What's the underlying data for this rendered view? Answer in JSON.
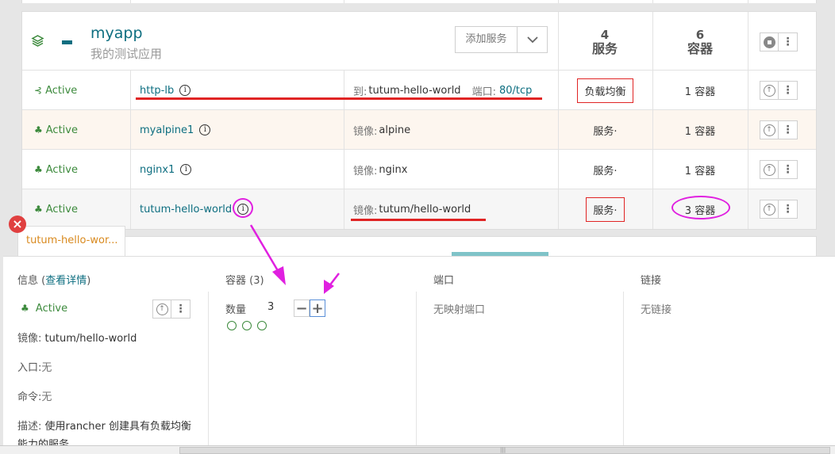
{
  "stack": {
    "name": "myapp",
    "description": "我的测试应用",
    "add_service_label": "添加服务",
    "services_count": "4",
    "services_unit": "服务",
    "containers_count": "6",
    "containers_unit": "容器"
  },
  "services": [
    {
      "status": "Active",
      "name": "http-lb",
      "detail_prefix": "到:",
      "detail_value": "tutum-hello-world",
      "port_label": "端口:",
      "port_value": "80/tcp",
      "type": "负载均衡",
      "containers": "1 容器"
    },
    {
      "status": "Active",
      "name": "myalpine1",
      "detail_prefix": "镜像:",
      "detail_value": "alpine",
      "type": "服务·",
      "containers": "1 容器"
    },
    {
      "status": "Active",
      "name": "nginx1",
      "detail_prefix": "镜像:",
      "detail_value": "nginx",
      "type": "服务·",
      "containers": "1 容器"
    },
    {
      "status": "Active",
      "name": "tutum-hello-world",
      "detail_prefix": "镜像:",
      "detail_value": "tutum/hello-world",
      "type": "服务·",
      "containers": "3 容器"
    }
  ],
  "info_i": "i",
  "tooltip_tab": "tutum-hello-wor...",
  "close_badge": "×",
  "panel": {
    "info_header": "信息 (",
    "info_link": "查看详情",
    "info_header_end": ")",
    "status": "Active",
    "image_label": "镜像:",
    "image_value": "tutum/hello-world",
    "entry_label": "入口:",
    "entry_value": "无",
    "command_label": "命令:",
    "command_value": "无",
    "desc_label": "描述:",
    "desc_value": "使用rancher 创建具有负载均衡",
    "desc_value_2": "能力的服务",
    "containers_header": "容器 (3)",
    "count_label": "数量",
    "count_value": "3",
    "minus": "−",
    "plus": "+",
    "ports_header": "端口",
    "ports_value": "无映射端口",
    "links_header": "链接",
    "links_value": "无链接"
  },
  "colors": {
    "accent": "#0d6e80",
    "active": "#3c8a3c",
    "annotation_red": "#e02424",
    "annotation_magenta": "#e020e0"
  },
  "icons": {
    "stack": "layers-icon",
    "lb": "load-balancer-icon",
    "service": "service-icon",
    "up": "upgrade-icon",
    "menu": "kebab-menu-icon",
    "stop": "stop-icon",
    "caret": "chevron-down-icon"
  }
}
